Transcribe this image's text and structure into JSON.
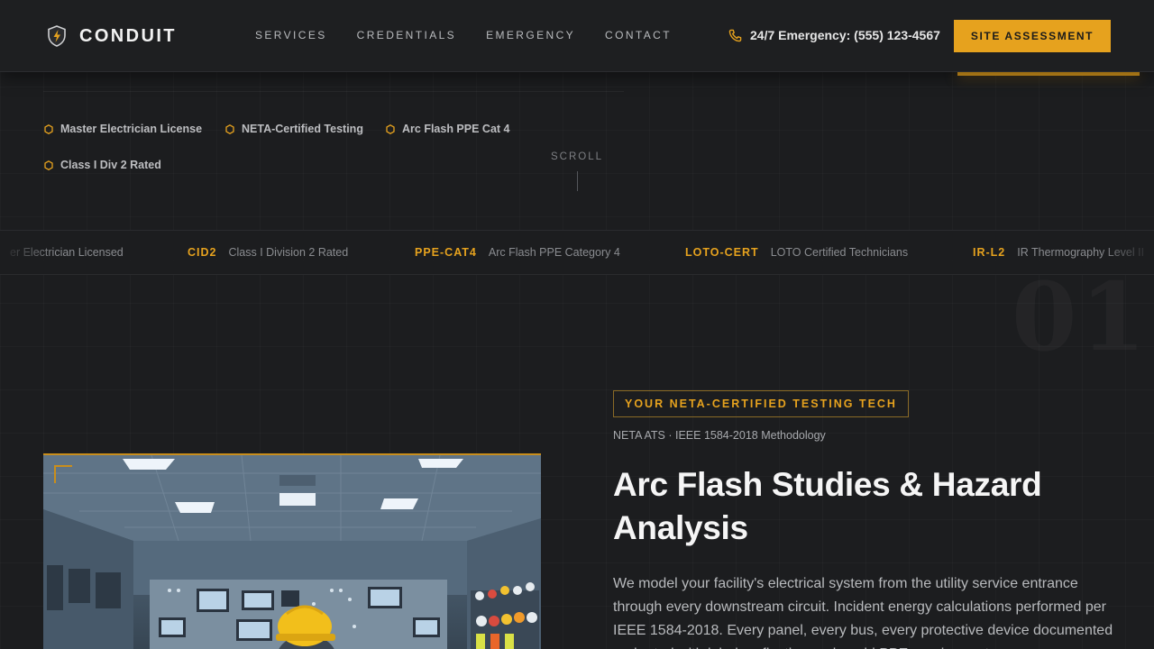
{
  "header": {
    "brand": "CONDUIT",
    "nav": [
      {
        "label": "SERVICES"
      },
      {
        "label": "CREDENTIALS"
      },
      {
        "label": "EMERGENCY"
      },
      {
        "label": "CONTACT"
      }
    ],
    "emergency_text": "24/7 Emergency: (555) 123-4567",
    "cta_label": "SITE ASSESSMENT"
  },
  "credentials": [
    {
      "label": "Master Electrician License"
    },
    {
      "label": "NETA-Certified Testing"
    },
    {
      "label": "Arc Flash PPE Cat 4"
    },
    {
      "label": "Class I Div 2 Rated"
    }
  ],
  "scroll_label": "SCROLL",
  "ticker": [
    {
      "code": "",
      "desc": "er Electrician Licensed"
    },
    {
      "code": "CID2",
      "desc": "Class I Division 2 Rated"
    },
    {
      "code": "PPE-CAT4",
      "desc": "Arc Flash PPE Category 4"
    },
    {
      "code": "LOTO-CERT",
      "desc": "LOTO Certified Technicians"
    },
    {
      "code": "IR-L2",
      "desc": "IR Thermography Level II"
    }
  ],
  "section": {
    "number": "01",
    "eyebrow": "YOUR NETA-CERTIFIED TESTING TECH",
    "methodology": "NETA ATS · IEEE 1584-2018 Methodology",
    "title": "Arc Flash Studies & Hazard Analysis",
    "description": "We model your facility's electrical system from the utility service entrance through every downstream circuit. Incident energy calculations performed per IEEE 1584-2018. Every panel, every bus, every protective device documented and rated with labels reflecting real-world PPE requirements."
  },
  "colors": {
    "accent": "#e6a21e",
    "background": "#1c1d1f",
    "text": "#f5f5f5"
  },
  "icons": {
    "brand": "shield-bolt-icon",
    "phone": "phone-icon",
    "credential": "hexagon-icon"
  }
}
